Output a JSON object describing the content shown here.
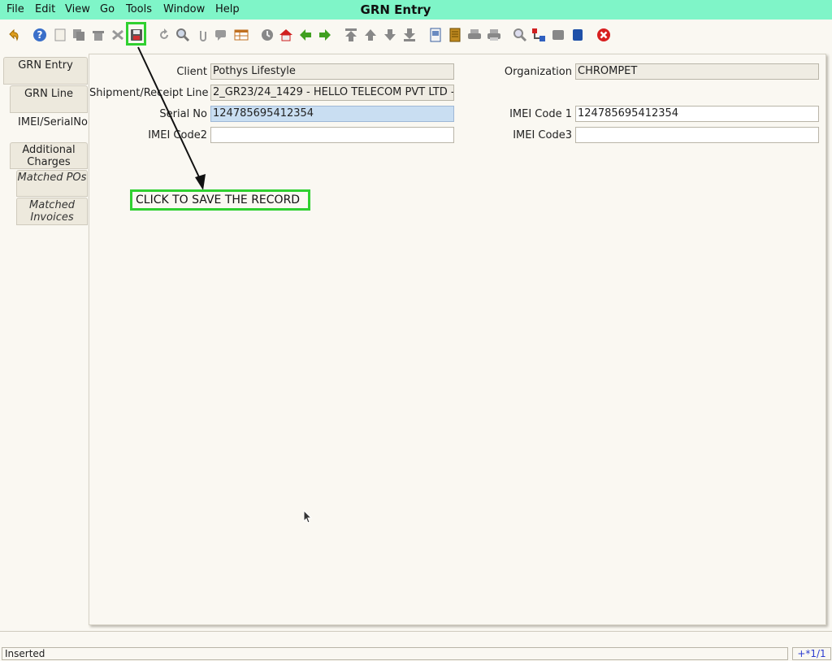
{
  "menu": {
    "items": [
      {
        "label": "File",
        "mnemonic": "F"
      },
      {
        "label": "Edit",
        "mnemonic": "E"
      },
      {
        "label": "View",
        "mnemonic": "V"
      },
      {
        "label": "Go",
        "mnemonic": "G"
      },
      {
        "label": "Tools",
        "mnemonic": "T"
      },
      {
        "label": "Window",
        "mnemonic": ""
      },
      {
        "label": "Help",
        "mnemonic": "H"
      }
    ]
  },
  "window": {
    "title": "GRN Entry"
  },
  "toolbar": {
    "icons": [
      "undo-icon",
      "help-icon",
      "new-record-icon",
      "copy-record-icon",
      "delete-icon",
      "delete-selection-icon",
      "save-icon",
      "refresh-icon",
      "find-icon",
      "attachment-icon",
      "chat-icon",
      "grid-toggle-icon",
      "history-icon",
      "home-icon",
      "parent-record-icon",
      "detail-record-icon",
      "first-record-icon",
      "previous-record-icon",
      "next-record-icon",
      "last-record-icon",
      "report-icon",
      "archive-icon",
      "print-preview-icon",
      "print-icon",
      "zoom-across-icon",
      "workflow-icon",
      "request-icon",
      "product-info-icon",
      "exit-icon"
    ]
  },
  "tabs": [
    {
      "label": "GRN Entry"
    },
    {
      "label": "GRN Line"
    },
    {
      "label": "IMEI/SerialNo"
    },
    {
      "label": "Additional Charges"
    },
    {
      "label": "Matched POs"
    },
    {
      "label": "Matched Invoices"
    }
  ],
  "form": {
    "client": {
      "label": "Client",
      "value": "Pothys Lifestyle"
    },
    "organization": {
      "label": "Organization",
      "value": "CHROMPET"
    },
    "shipment_line": {
      "label": "Shipment/Receipt Line",
      "value": "2_GR23/24_1429 - HELLO TELECOM PVT LTD -"
    },
    "serial_no": {
      "label": "Serial No",
      "value": "124785695412354"
    },
    "imei_code1": {
      "label": "IMEI Code 1",
      "value": "124785695412354"
    },
    "imei_code2": {
      "label": "IMEI Code2",
      "value": ""
    },
    "imei_code3": {
      "label": "IMEI Code3",
      "value": ""
    }
  },
  "annotation": {
    "text": "CLICK TO SAVE THE RECORD"
  },
  "status": {
    "message": "Inserted",
    "record_info": "+*1/1"
  },
  "colors": {
    "menubar": "#7ff5c8",
    "highlight": "#30d030",
    "selected_field": "#c9def2"
  }
}
